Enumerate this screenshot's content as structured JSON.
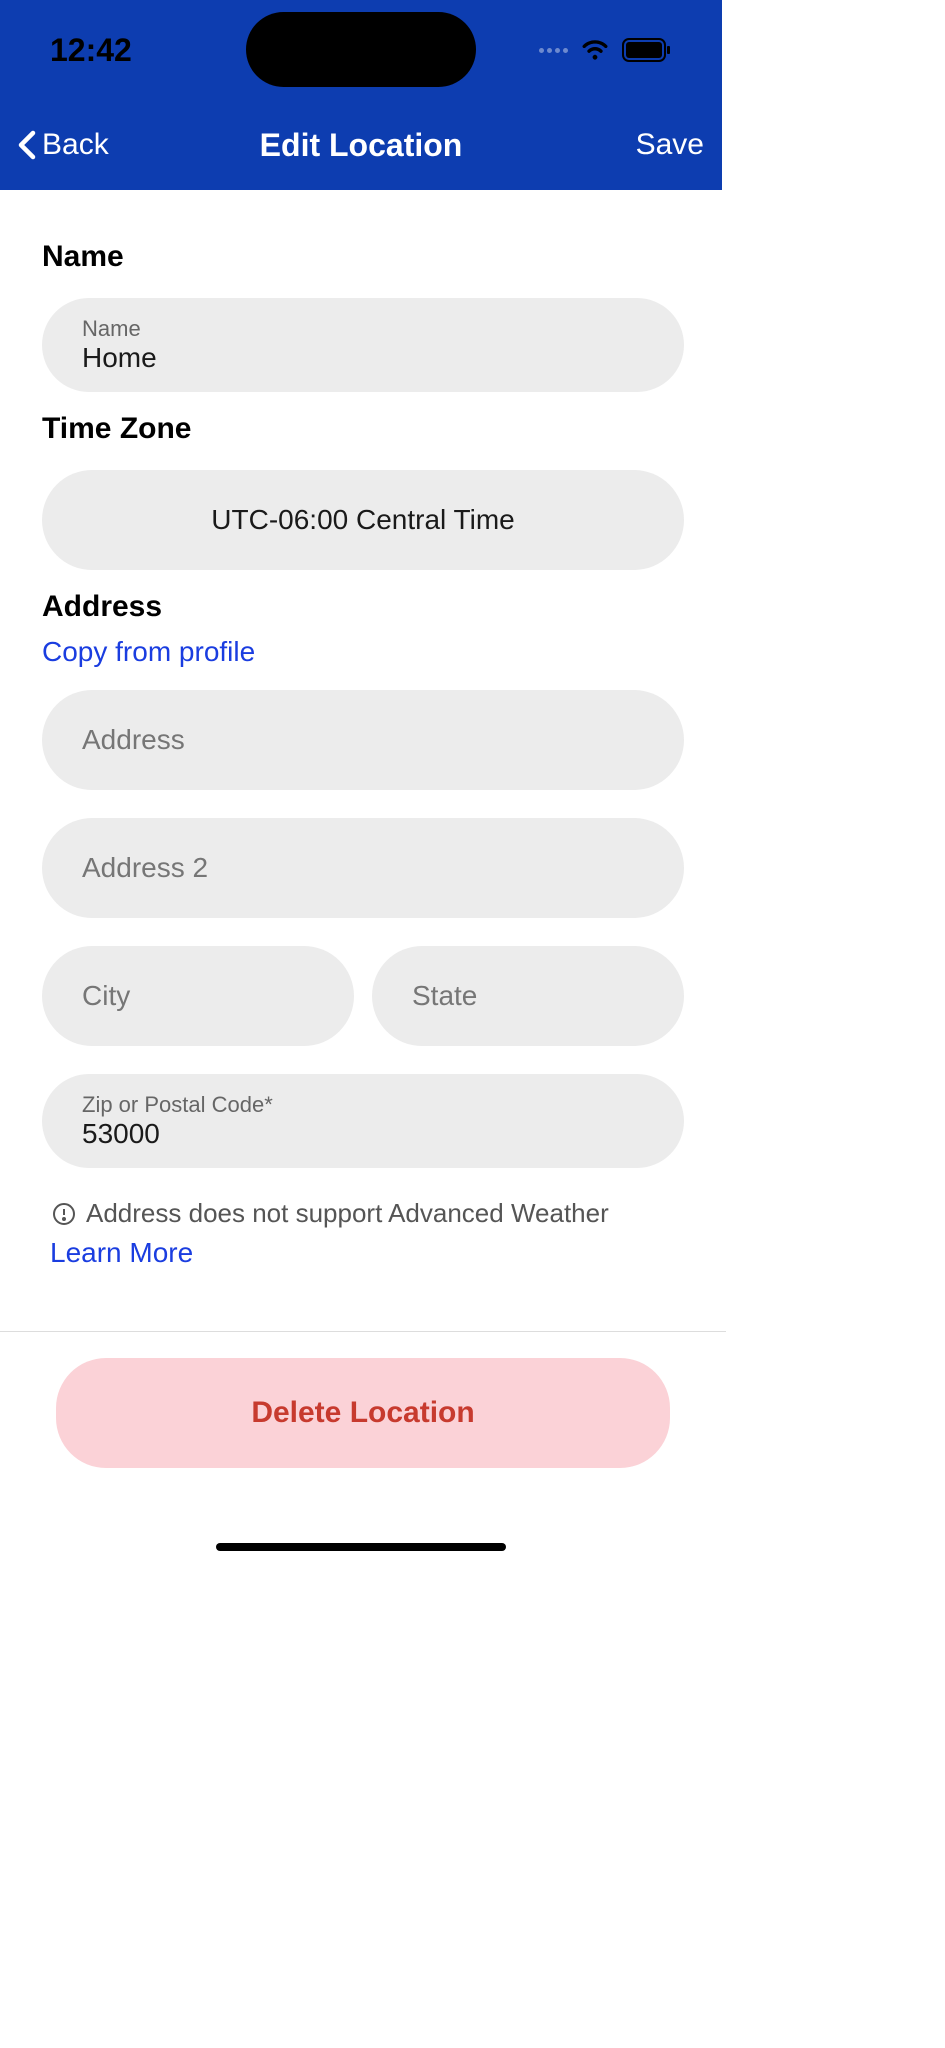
{
  "statusBar": {
    "time": "12:42"
  },
  "nav": {
    "back": "Back",
    "title": "Edit Location",
    "save": "Save"
  },
  "sections": {
    "nameLabel": "Name",
    "timezoneLabel": "Time Zone",
    "addressLabel": "Address"
  },
  "fields": {
    "nameSmall": "Name",
    "nameValue": "Home",
    "timezone": "UTC-06:00 Central Time",
    "copyLink": "Copy from profile",
    "addressPlaceholder": "Address",
    "address2Placeholder": "Address 2",
    "cityPlaceholder": "City",
    "statePlaceholder": "State",
    "zipLabel": "Zip or Postal Code*",
    "zipValue": "53000"
  },
  "warning": {
    "text": "Address does not support Advanced Weather",
    "learnMore": "Learn More"
  },
  "delete": "Delete Location"
}
